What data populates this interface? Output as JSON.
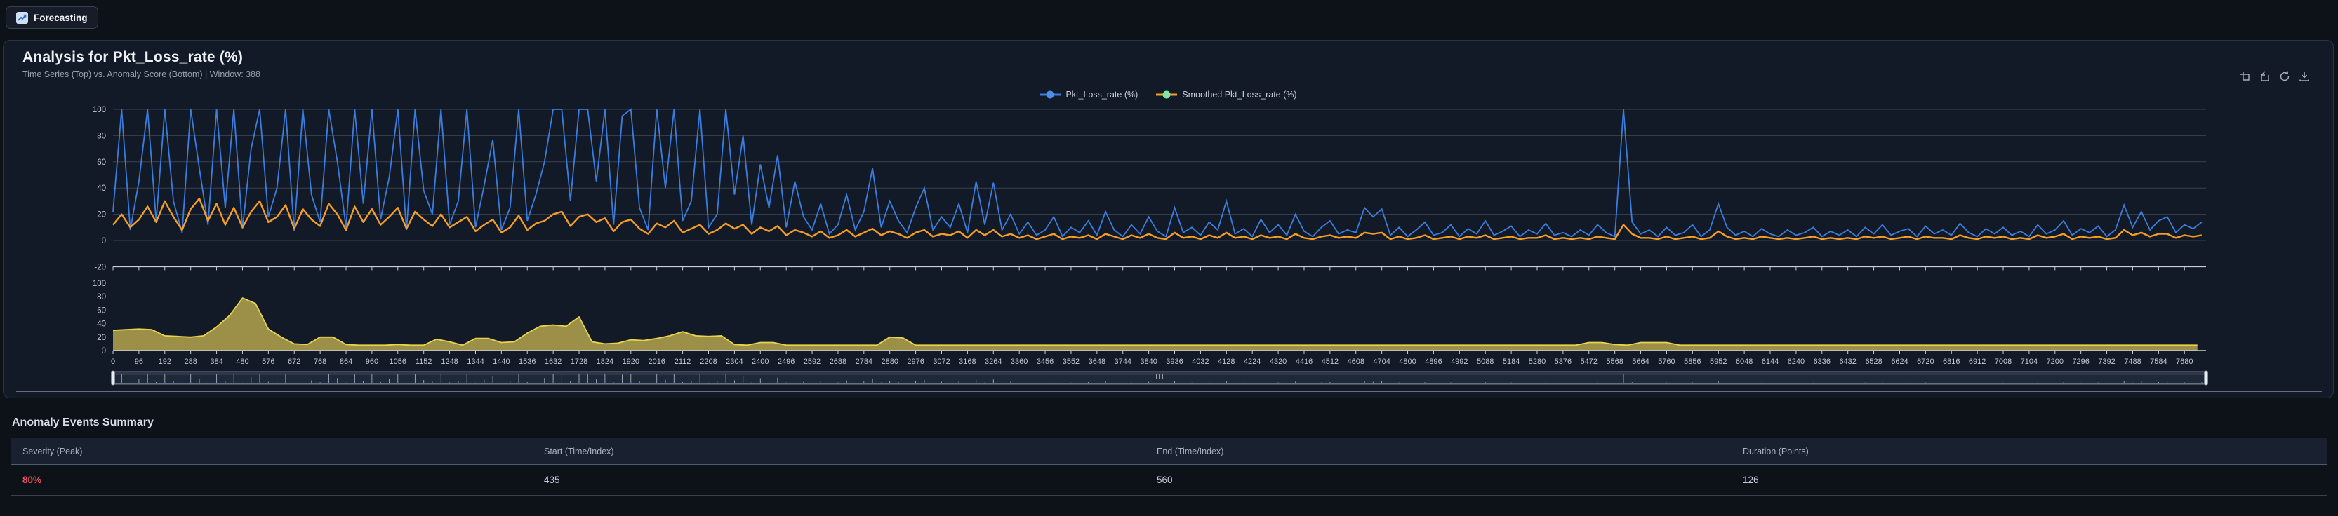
{
  "topbar": {
    "forecasting_label": "Forecasting"
  },
  "panel": {
    "title": "Analysis for Pkt_Loss_rate (%)",
    "subtitle": "Time Series (Top) vs. Anomaly Score (Bottom) | Window: 388",
    "toolbox_icons": [
      "zoom-box-icon",
      "zoom-reset-icon",
      "restore-icon",
      "download-icon"
    ]
  },
  "chart_data": {
    "type": "line",
    "title": "Analysis for Pkt_Loss_rate (%)",
    "x_range": [
      0,
      7760
    ],
    "x_tick_labels": [
      0,
      96,
      192,
      288,
      384,
      480,
      576,
      672,
      768,
      864,
      960,
      1056,
      1152,
      1248,
      1344,
      1440,
      1536,
      1632,
      1728,
      1824,
      1920,
      2016,
      2112,
      2208,
      2304,
      2400,
      2496,
      2592,
      2688,
      2784,
      2880,
      2976,
      3072,
      3168,
      3264,
      3360,
      3456,
      3552,
      3648,
      3744,
      3840,
      3936,
      4032,
      4128,
      4224,
      4320,
      4416,
      4512,
      4608,
      4704,
      4800,
      4896,
      4992,
      5088,
      5184,
      5280,
      5376,
      5472,
      5568,
      5664,
      5760,
      5856,
      5952,
      6048,
      6144,
      6240,
      6336,
      6432,
      6528,
      6624,
      6720,
      6816,
      6912,
      7008,
      7104,
      7200,
      7296,
      7392,
      7488,
      7584,
      7680
    ],
    "top": {
      "ylim": [
        -20,
        100
      ],
      "yticks": [
        -20,
        0,
        20,
        40,
        60,
        80,
        100
      ],
      "x_step": 32,
      "series": [
        {
          "name": "Pkt_Loss_rate (%)",
          "color": "#3b7ddd",
          "symbol_color": "#4d8fe8",
          "values": [
            22,
            100,
            8,
            45,
            100,
            15,
            100,
            30,
            6,
            100,
            55,
            12,
            100,
            25,
            100,
            9,
            70,
            100,
            18,
            40,
            100,
            7,
            100,
            35,
            14,
            100,
            60,
            10,
            100,
            28,
            100,
            16,
            48,
            100,
            8,
            100,
            38,
            20,
            100,
            12,
            30,
            100,
            10,
            42,
            77,
            8,
            25,
            100,
            15,
            35,
            60,
            100,
            100,
            30,
            100,
            100,
            45,
            100,
            12,
            95,
            100,
            25,
            8,
            100,
            40,
            100,
            15,
            30,
            100,
            10,
            20,
            100,
            35,
            80,
            12,
            58,
            25,
            65,
            10,
            45,
            18,
            8,
            28,
            5,
            12,
            35,
            8,
            22,
            55,
            10,
            30,
            15,
            6,
            25,
            40,
            8,
            18,
            10,
            28,
            6,
            45,
            12,
            44,
            8,
            20,
            5,
            14,
            4,
            8,
            18,
            3,
            10,
            6,
            15,
            4,
            22,
            8,
            3,
            12,
            5,
            18,
            7,
            3,
            25,
            6,
            10,
            4,
            14,
            8,
            30,
            5,
            9,
            3,
            16,
            6,
            12,
            4,
            20,
            7,
            3,
            10,
            15,
            5,
            8,
            6,
            25,
            18,
            24,
            4,
            10,
            3,
            8,
            14,
            4,
            6,
            12,
            3,
            9,
            5,
            15,
            4,
            7,
            11,
            3,
            8,
            5,
            13,
            4,
            6,
            3,
            8,
            4,
            12,
            6,
            3,
            100,
            14,
            5,
            8,
            3,
            10,
            4,
            6,
            12,
            3,
            8,
            28,
            10,
            4,
            7,
            3,
            9,
            5,
            3,
            8,
            4,
            6,
            10,
            3,
            7,
            4,
            8,
            3,
            10,
            5,
            12,
            4,
            7,
            9,
            3,
            11,
            5,
            8,
            4,
            13,
            6,
            3,
            9,
            5,
            10,
            4,
            7,
            3,
            12,
            5,
            8,
            15,
            4,
            9,
            6,
            11,
            3,
            8,
            27,
            10,
            22,
            8,
            15,
            18,
            6,
            12,
            9,
            14
          ]
        },
        {
          "name": "Smoothed Pkt_Loss_rate (%)",
          "color": "#f59e27",
          "symbol_color": "#7de8a5",
          "values": [
            12,
            20,
            10,
            16,
            26,
            14,
            30,
            18,
            8,
            24,
            32,
            15,
            28,
            12,
            25,
            10,
            22,
            30,
            14,
            18,
            27,
            9,
            24,
            16,
            11,
            28,
            20,
            8,
            26,
            14,
            24,
            12,
            18,
            25,
            9,
            22,
            16,
            11,
            20,
            10,
            14,
            18,
            7,
            12,
            16,
            6,
            10,
            19,
            8,
            13,
            15,
            20,
            22,
            11,
            18,
            20,
            14,
            17,
            7,
            14,
            16,
            9,
            5,
            13,
            10,
            15,
            6,
            9,
            12,
            5,
            8,
            13,
            9,
            12,
            5,
            10,
            7,
            11,
            4,
            8,
            6,
            3,
            7,
            2,
            4,
            8,
            3,
            6,
            9,
            4,
            7,
            5,
            2,
            6,
            8,
            3,
            5,
            4,
            7,
            2,
            8,
            4,
            8,
            3,
            5,
            2,
            4,
            1,
            3,
            5,
            1,
            3,
            2,
            4,
            1,
            5,
            3,
            1,
            4,
            2,
            5,
            2,
            1,
            6,
            2,
            3,
            1,
            4,
            2,
            6,
            2,
            3,
            1,
            4,
            2,
            3,
            1,
            5,
            2,
            1,
            3,
            4,
            2,
            3,
            2,
            6,
            5,
            6,
            1,
            3,
            1,
            2,
            4,
            1,
            2,
            3,
            1,
            3,
            2,
            4,
            1,
            2,
            3,
            1,
            2,
            2,
            4,
            1,
            2,
            1,
            2,
            1,
            3,
            2,
            1,
            12,
            5,
            2,
            2,
            1,
            3,
            1,
            2,
            3,
            1,
            2,
            7,
            3,
            1,
            2,
            1,
            3,
            2,
            1,
            2,
            1,
            2,
            3,
            1,
            2,
            1,
            2,
            1,
            3,
            2,
            3,
            1,
            2,
            3,
            1,
            3,
            2,
            2,
            1,
            4,
            2,
            1,
            3,
            2,
            3,
            1,
            2,
            1,
            4,
            2,
            3,
            5,
            1,
            3,
            2,
            3,
            1,
            2,
            8,
            4,
            6,
            3,
            5,
            5,
            2,
            4,
            3,
            4
          ]
        }
      ]
    },
    "bottom": {
      "name": "Anomaly Score",
      "ylim": [
        0,
        100
      ],
      "yticks": [
        0,
        20,
        40,
        60,
        80,
        100
      ],
      "x_step": 48,
      "fill_color": "#a89a4b",
      "line_color": "#e9d44e",
      "values": [
        30,
        31,
        32,
        31,
        22,
        21,
        20,
        22,
        35,
        52,
        78,
        70,
        32,
        20,
        10,
        9,
        20,
        20,
        9,
        8,
        8,
        8,
        9,
        8,
        8,
        17,
        13,
        8,
        18,
        18,
        12,
        13,
        26,
        36,
        38,
        36,
        50,
        13,
        10,
        11,
        16,
        15,
        18,
        22,
        28,
        22,
        21,
        22,
        9,
        8,
        12,
        12,
        8,
        8,
        8,
        8,
        8,
        8,
        8,
        8,
        20,
        19,
        8,
        8,
        8,
        8,
        8,
        8,
        8,
        8,
        8,
        8,
        8,
        8,
        8,
        8,
        8,
        8,
        8,
        8,
        8,
        8,
        8,
        8,
        8,
        8,
        8,
        8,
        8,
        8,
        8,
        8,
        8,
        8,
        8,
        8,
        8,
        8,
        8,
        8,
        8,
        8,
        8,
        8,
        8,
        8,
        8,
        8,
        8,
        8,
        8,
        8,
        8,
        8,
        12,
        12,
        9,
        8,
        12,
        12,
        12,
        8,
        8,
        8,
        8,
        8,
        8,
        8,
        8,
        8,
        8,
        8,
        8,
        8,
        8,
        8,
        8,
        8,
        8,
        8,
        8,
        8,
        8,
        8,
        8,
        8,
        8,
        8,
        8,
        8,
        8,
        8,
        8,
        8,
        8,
        8,
        8,
        8,
        8,
        8,
        8,
        8
      ]
    },
    "window": 388
  },
  "summary": {
    "heading": "Anomaly Events Summary",
    "columns": [
      "Severity (Peak)",
      "Start (Time/Index)",
      "End (Time/Index)",
      "Duration (Points)"
    ],
    "rows": [
      {
        "severity": "80%",
        "severity_color": "#ef5661",
        "start": "435",
        "end": "560",
        "duration": "126"
      }
    ]
  },
  "colors": {
    "page_bg": "#0d1118",
    "panel_bg": "#131a27",
    "panel_border": "#2b3344",
    "grid_line": "#3a4150",
    "axis_line": "#c9ced8",
    "axis_label": "#c3c8d2",
    "series_blue": "#3b7ddd",
    "series_orange": "#f59e27",
    "anomaly_fill": "#a89a4b",
    "anomaly_stroke": "#e9d44e",
    "severity_red": "#ef5661"
  }
}
